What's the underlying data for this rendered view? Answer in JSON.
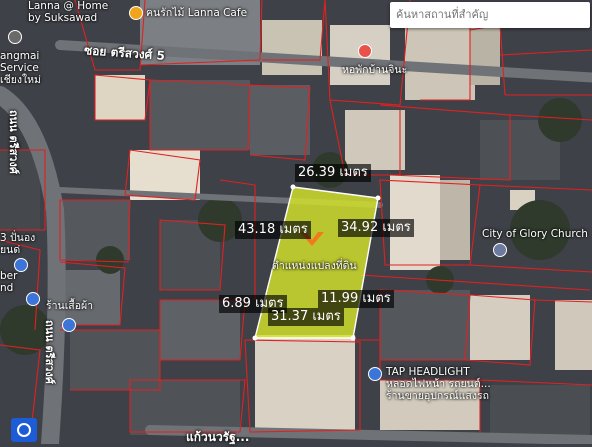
{
  "search": {
    "placeholder": "ค้นหาสถานที่สำคัญ"
  },
  "measurements": {
    "top": "26.39 เมตร",
    "left": "43.18 เมตร",
    "right": "34.92 เมตร",
    "mid_right": "11.99 เมตร",
    "bottom_left": "6.89 เมตร",
    "bottom": "31.37 เมตร"
  },
  "parcel": {
    "label": "ตำแหน่งแปลงที่ดิน",
    "fill_color": "#d4e42a"
  },
  "pois": {
    "home": "Lanna @ Home\nby Suksawad",
    "cafe": "ฅนรักไม้ Lanna Cafe",
    "hostel": "หอพักบ้านจินะ",
    "service": "angmai\nService\nเชียงใหม่",
    "church": "City of Glory Church",
    "left_store": "3 ปั่นอง\nยนด่",
    "barber": "ber\nnd",
    "shop": "ร้านเสื้อผ้า",
    "headlight": "TAP HEADLIGHT\nหลอดไฟหน้า รถยนต์...\nร้านขายอุปกรณ์แสงรถ"
  },
  "roads": {
    "soi5": "ซอย ตรีสวงศ์ 5",
    "left_road": "ถนน ตรีสวงศ์",
    "left_road2": "ถนน ตรีสวงศ์",
    "bottom_road": "แก้วนวรัฐ..."
  },
  "colors": {
    "parcel_line": "#e32020",
    "measure_bg": "#000000",
    "accent": "#1e5bd6"
  }
}
